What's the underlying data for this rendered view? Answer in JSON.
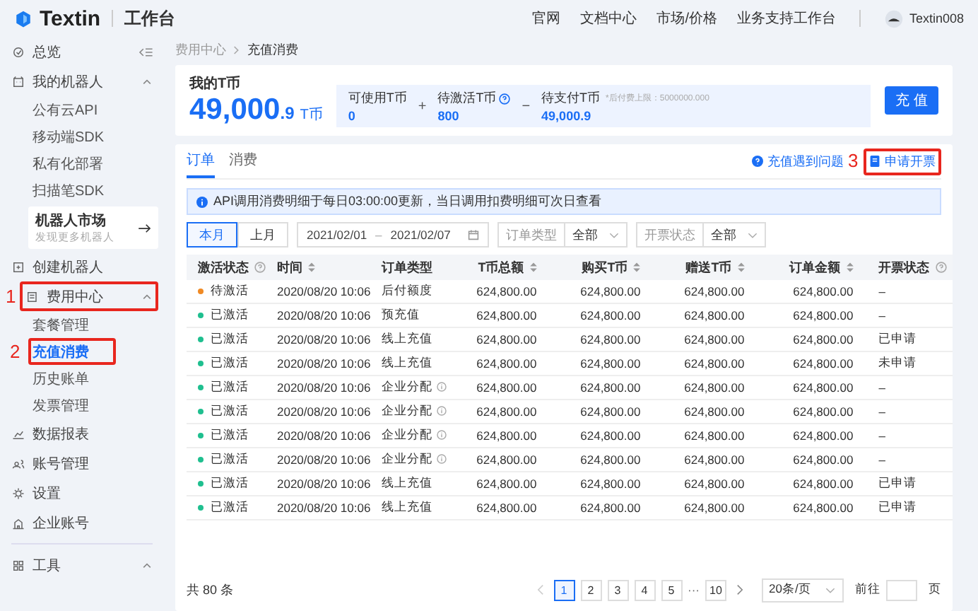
{
  "topbar": {
    "logo": "Textin",
    "workspace": "工作台",
    "links": [
      "官网",
      "文档中心",
      "市场/价格",
      "业务支持工作台"
    ],
    "user": "Textin008"
  },
  "breadcrumb": [
    "费用中心",
    "充值消费"
  ],
  "sidebar": {
    "items": [
      {
        "label": "总览",
        "kind": "link"
      },
      {
        "label": "我的机器人",
        "kind": "group",
        "expanded": true,
        "children": [
          {
            "label": "公有云API",
            "selected": false
          },
          {
            "label": "移动端SDK",
            "selected": false
          },
          {
            "label": "私有化部署",
            "selected": false
          },
          {
            "label": "扫描笔SDK",
            "selected": false
          }
        ],
        "promo": {
          "title": "机器人市场",
          "subtitle": "发现更多机器人"
        }
      },
      {
        "label": "创建机器人",
        "kind": "link"
      },
      {
        "label": "费用中心",
        "kind": "group",
        "expanded": true,
        "annotation": "1",
        "children": [
          {
            "label": "套餐管理",
            "selected": false
          },
          {
            "label": "充值消费",
            "selected": true,
            "annotation": "2"
          },
          {
            "label": "历史账单",
            "selected": false
          },
          {
            "label": "发票管理",
            "selected": false
          }
        ]
      },
      {
        "label": "数据报表",
        "kind": "link"
      },
      {
        "label": "账号管理",
        "kind": "link"
      },
      {
        "label": "设置",
        "kind": "link"
      },
      {
        "label": "企业账号",
        "kind": "link"
      },
      {
        "label": "工具",
        "kind": "group",
        "expanded": true
      }
    ]
  },
  "balance": {
    "title": "我的T币",
    "whole": "49,000",
    "fraction": ".9",
    "unit": "T币",
    "stats": [
      {
        "label": "可使用T币",
        "value": "0",
        "op": "+"
      },
      {
        "label": "待激活T币",
        "value": "800",
        "help": true,
        "op": "−"
      },
      {
        "label": "待支付T币",
        "note": "*后付费上限：5000000.000",
        "value": "49,000.9"
      }
    ],
    "button": "充 值"
  },
  "tabs": [
    {
      "label": "订单",
      "selected": true
    },
    {
      "label": "消费",
      "selected": false
    }
  ],
  "links": [
    {
      "label": "充值遇到问题",
      "kind": "help"
    },
    {
      "label": "申请开票",
      "kind": "invoice",
      "annotation": "3"
    }
  ],
  "alert": "API调用消费明细于每日03:00:00更新，当日调用扣费明细可次日查看",
  "filters": {
    "periods": [
      {
        "label": "本月",
        "selected": true
      },
      {
        "label": "上月",
        "selected": false
      }
    ],
    "date_from": "2021/02/01",
    "date_sep": "–",
    "date_to": "2021/02/07",
    "selects": [
      {
        "label": "订单类型",
        "value": "全部"
      },
      {
        "label": "开票状态",
        "value": "全部"
      }
    ]
  },
  "table": {
    "columns": [
      {
        "label": "激活状态",
        "help": true,
        "sortable": false
      },
      {
        "label": "时间",
        "help": false,
        "sortable": true
      },
      {
        "label": "订单类型",
        "help": false,
        "sortable": false
      },
      {
        "label": "T币总额",
        "help": false,
        "sortable": true
      },
      {
        "label": "购买T币",
        "help": false,
        "sortable": true
      },
      {
        "label": "赠送T币",
        "help": false,
        "sortable": true
      },
      {
        "label": "订单金额",
        "help": false,
        "sortable": true
      },
      {
        "label": "开票状态",
        "help": true,
        "sortable": false
      }
    ],
    "rows": [
      {
        "status": "待激活",
        "color": "#f08a24",
        "time": "2020/08/20 10:06",
        "type": "后付额度",
        "info": false,
        "total": "624,800.00",
        "bought": "624,800.00",
        "gift": "624,800.00",
        "amount": "624,800.00",
        "invoice": "–"
      },
      {
        "status": "已激活",
        "color": "#1fbf8f",
        "time": "2020/08/20 10:06",
        "type": "预充值",
        "info": false,
        "total": "624,800.00",
        "bought": "624,800.00",
        "gift": "624,800.00",
        "amount": "624,800.00",
        "invoice": "–"
      },
      {
        "status": "已激活",
        "color": "#1fbf8f",
        "time": "2020/08/20 10:06",
        "type": "线上充值",
        "info": false,
        "total": "624,800.00",
        "bought": "624,800.00",
        "gift": "624,800.00",
        "amount": "624,800.00",
        "invoice": "已申请"
      },
      {
        "status": "已激活",
        "color": "#1fbf8f",
        "time": "2020/08/20 10:06",
        "type": "线上充值",
        "info": false,
        "total": "624,800.00",
        "bought": "624,800.00",
        "gift": "624,800.00",
        "amount": "624,800.00",
        "invoice": "未申请"
      },
      {
        "status": "已激活",
        "color": "#1fbf8f",
        "time": "2020/08/20 10:06",
        "type": "企业分配",
        "info": true,
        "total": "624,800.00",
        "bought": "624,800.00",
        "gift": "624,800.00",
        "amount": "624,800.00",
        "invoice": "–"
      },
      {
        "status": "已激活",
        "color": "#1fbf8f",
        "time": "2020/08/20 10:06",
        "type": "企业分配",
        "info": true,
        "total": "624,800.00",
        "bought": "624,800.00",
        "gift": "624,800.00",
        "amount": "624,800.00",
        "invoice": "–"
      },
      {
        "status": "已激活",
        "color": "#1fbf8f",
        "time": "2020/08/20 10:06",
        "type": "企业分配",
        "info": true,
        "total": "624,800.00",
        "bought": "624,800.00",
        "gift": "624,800.00",
        "amount": "624,800.00",
        "invoice": "–"
      },
      {
        "status": "已激活",
        "color": "#1fbf8f",
        "time": "2020/08/20 10:06",
        "type": "企业分配",
        "info": true,
        "total": "624,800.00",
        "bought": "624,800.00",
        "gift": "624,800.00",
        "amount": "624,800.00",
        "invoice": "–"
      },
      {
        "status": "已激活",
        "color": "#1fbf8f",
        "time": "2020/08/20 10:06",
        "type": "线上充值",
        "info": false,
        "total": "624,800.00",
        "bought": "624,800.00",
        "gift": "624,800.00",
        "amount": "624,800.00",
        "invoice": "已申请"
      },
      {
        "status": "已激活",
        "color": "#1fbf8f",
        "time": "2020/08/20 10:06",
        "type": "线上充值",
        "info": false,
        "total": "624,800.00",
        "bought": "624,800.00",
        "gift": "624,800.00",
        "amount": "624,800.00",
        "invoice": "已申请"
      }
    ]
  },
  "footer": {
    "total": "共 80 条",
    "pages": [
      {
        "label": "1",
        "selected": true
      },
      {
        "label": "2",
        "selected": false
      },
      {
        "label": "3",
        "selected": false
      },
      {
        "label": "4",
        "selected": false
      },
      {
        "label": "5",
        "selected": false
      },
      {
        "label": "···",
        "kind": "ellipsis"
      },
      {
        "label": "10",
        "selected": false
      }
    ],
    "page_size": "20条/页",
    "goto": "前往",
    "page_unit": "页"
  }
}
